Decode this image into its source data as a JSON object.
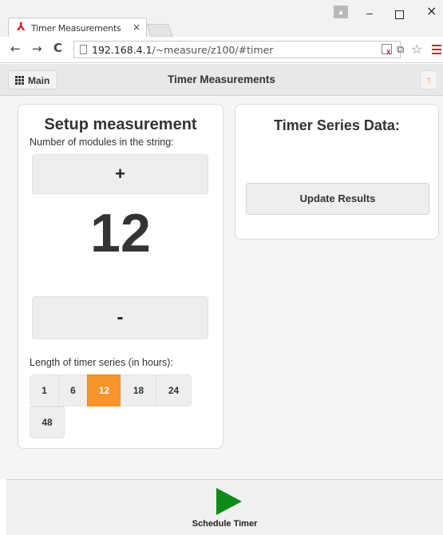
{
  "browser": {
    "tab_title": "Timer Measurements",
    "tab_close": "×",
    "url_host": "192.168.4.1",
    "url_path": "/~measure/z100/#timer",
    "back": "←",
    "forward": "→",
    "reload": "C",
    "star": "☆",
    "minimize": "–",
    "close": "×"
  },
  "header": {
    "main_label": "Main",
    "title": "Timer Measurements",
    "help": "?"
  },
  "setup": {
    "title": "Setup measurement",
    "subtitle": "Number of modules in the string:",
    "plus": "+",
    "count": "12",
    "minus": "-",
    "series_label": "Length of timer series (in hours):",
    "hour_options": [
      "1",
      "6",
      "12",
      "18",
      "24",
      "48"
    ],
    "selected_hour": "12"
  },
  "results": {
    "title": "Timer Series Data:",
    "update_label": "Update Results"
  },
  "footer": {
    "schedule_label": "Schedule Timer"
  },
  "colors": {
    "accent": "#f5952b",
    "play": "#0f8a19",
    "brand_red": "#d0202e"
  }
}
